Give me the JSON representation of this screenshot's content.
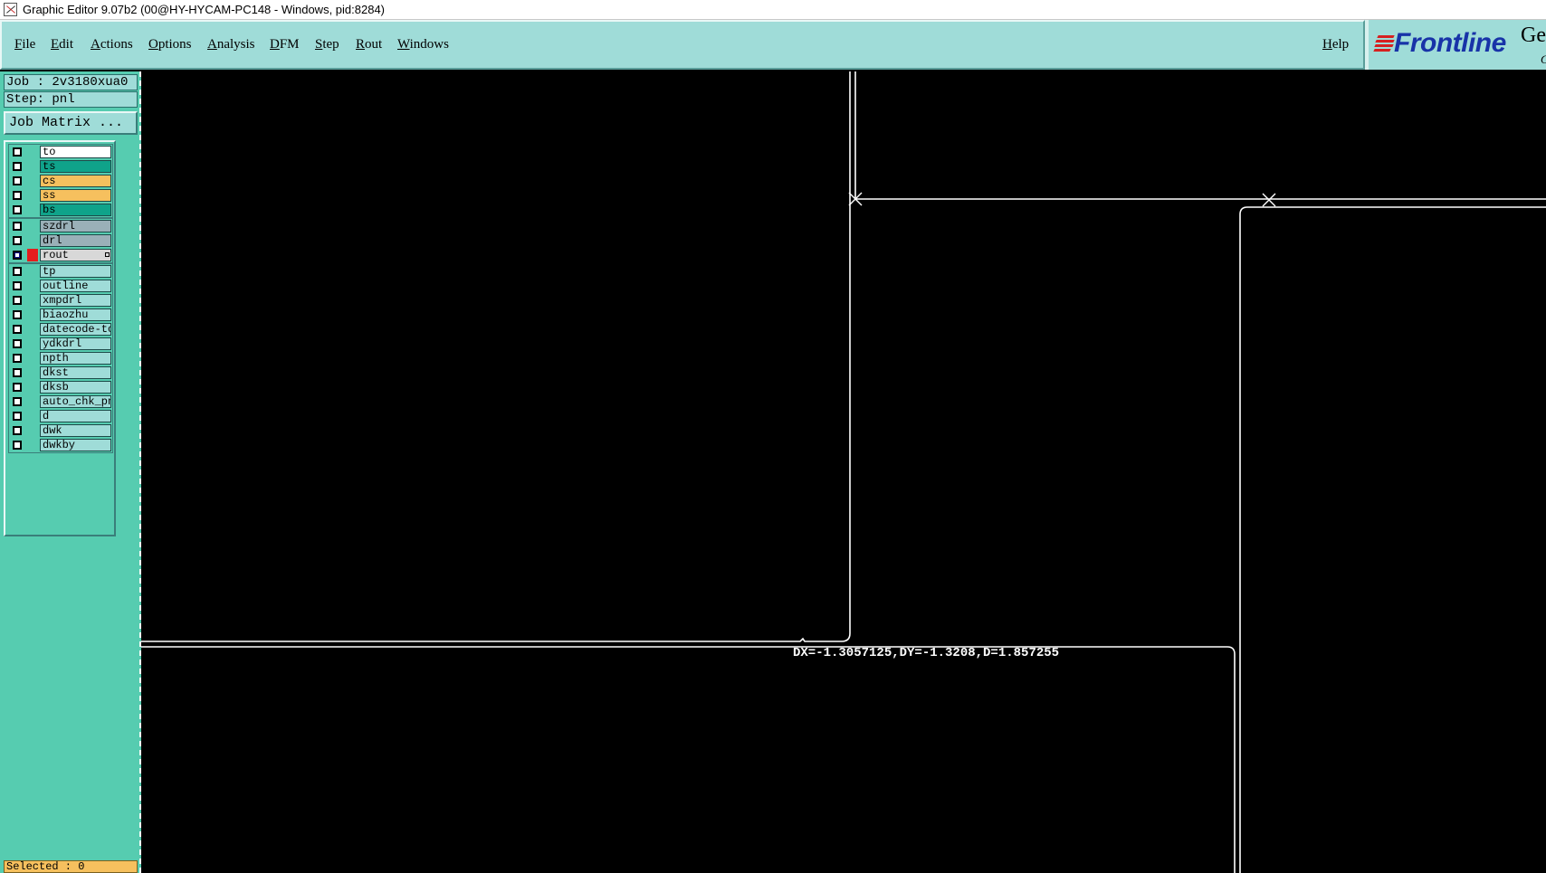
{
  "window": {
    "title": "Graphic Editor 9.07b2 (00@HY-HYCAM-PC148 - Windows, pid:8284)"
  },
  "menu": {
    "items": [
      "File",
      "Edit",
      "Actions",
      "Options",
      "Analysis",
      "DFM",
      "Step",
      "Rout",
      "Windows"
    ],
    "help": "Help"
  },
  "logo": {
    "text": "Frontline",
    "side": "Ge",
    "side_small": "G"
  },
  "job": {
    "label": "Job : 2v3180xua0",
    "step": "Step: pnl",
    "matrix_button": "Job Matrix ..."
  },
  "layers": {
    "group1": [
      {
        "name": "to",
        "color": "#ffffff"
      },
      {
        "name": "ts",
        "color": "#0fa38a"
      },
      {
        "name": "cs",
        "color": "#f6c05e"
      },
      {
        "name": "ss",
        "color": "#f6c05e"
      },
      {
        "name": "bs",
        "color": "#0fa38a"
      }
    ],
    "group2": [
      {
        "name": "szdrl",
        "color": "#9ab0b8"
      },
      {
        "name": "drl",
        "color": "#9ab0b8"
      },
      {
        "name": "rout",
        "color": "#d8d8d8",
        "active": true
      }
    ],
    "group3": [
      {
        "name": "tp",
        "color": "#9fdcd8"
      },
      {
        "name": "outline",
        "color": "#9fdcd8"
      },
      {
        "name": "xmpdrl",
        "color": "#9fdcd8"
      },
      {
        "name": "biaozhu",
        "color": "#9fdcd8"
      },
      {
        "name": "datecode-to",
        "color": "#9fdcd8"
      },
      {
        "name": "ydkdrl",
        "color": "#9fdcd8"
      },
      {
        "name": "npth",
        "color": "#9fdcd8"
      },
      {
        "name": "dkst",
        "color": "#9fdcd8"
      },
      {
        "name": "dksb",
        "color": "#9fdcd8"
      },
      {
        "name": "auto_chk_pnl",
        "color": "#9fdcd8"
      },
      {
        "name": "d",
        "color": "#9fdcd8"
      },
      {
        "name": "dwk",
        "color": "#9fdcd8"
      },
      {
        "name": "dwkby",
        "color": "#9fdcd8"
      }
    ]
  },
  "status": {
    "selected": "Selected : 0"
  },
  "measure": {
    "readout": "DX=-1.3057125,DY=-1.3208,D=1.857255"
  },
  "colors": {
    "menu_bg": "#9fdcd8",
    "panel_bg": "#56ccb0",
    "canvas_bg": "#000000",
    "logo_blue": "#1833a8",
    "logo_red": "#d62020"
  },
  "icons": {
    "app": "graphic-editor-app-icon",
    "logo_mark": "frontline-stripes-icon"
  }
}
